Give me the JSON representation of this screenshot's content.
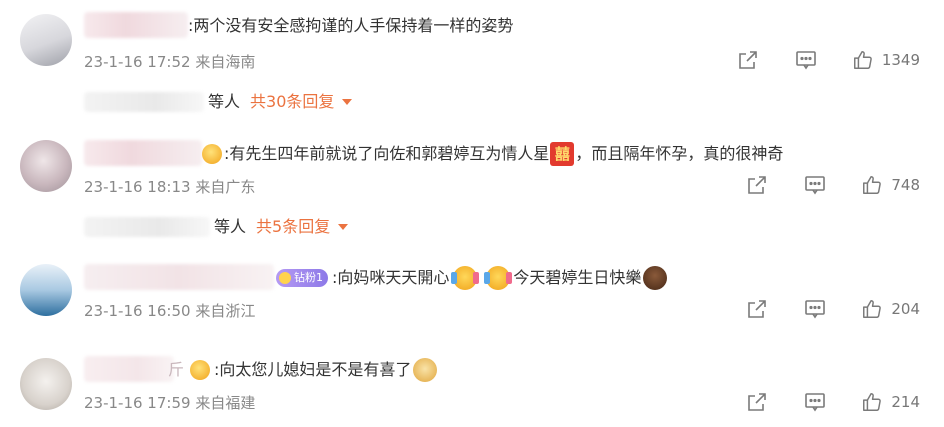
{
  "comments": [
    {
      "text": ":两个没有安全感拘谨的人手保持着一样的姿势",
      "time": "23-1-16 17:52",
      "location": "来自海南",
      "likes": "1349",
      "replies": {
        "etc": "等人",
        "link": "共30条回复"
      }
    },
    {
      "text_before": ":有先生四年前就说了向佐和郭碧婷互为情人星",
      "emoji_xi": "囍",
      "text_after": "，而且隔年怀孕，真的很神奇",
      "time": "23-1-16 18:13",
      "location": "来自广东",
      "likes": "748",
      "replies": {
        "etc": "等人",
        "link": "共5条回复"
      }
    },
    {
      "fan_badge": "钻粉1",
      "text_before": ":向妈咪天天開心",
      "text_after": "今天碧婷生日快樂",
      "time": "23-1-16 16:50",
      "location": "来自浙江",
      "likes": "204"
    },
    {
      "name_suffix": "斤",
      "text": ":向太您儿媳妇是不是有喜了",
      "time": "23-1-16 17:59",
      "location": "来自福建",
      "likes": "214"
    }
  ],
  "icons": {
    "share": "share-icon",
    "comment": "comment-icon",
    "like": "thumbs-up-icon"
  },
  "colors": {
    "accent": "#eb7340",
    "text": "#333333",
    "meta": "#888888"
  }
}
